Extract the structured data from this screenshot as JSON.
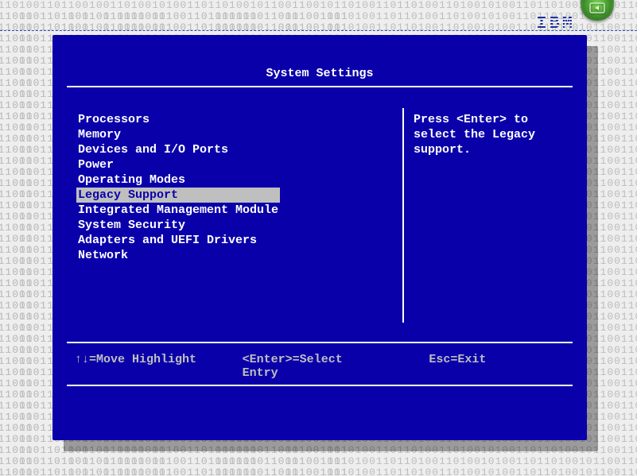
{
  "brand": "IBM",
  "title": "System Settings",
  "menu": {
    "items": [
      "Processors",
      "Memory",
      "Devices and I/O Ports",
      "Power",
      "Operating Modes",
      "Legacy Support",
      "Integrated Management Module",
      "System Security",
      "Adapters and UEFI Drivers",
      "Network"
    ],
    "selected_index": 5
  },
  "help": {
    "line1": "Press <Enter> to",
    "line2": "select the Legacy",
    "line3": "support."
  },
  "footer": {
    "move": "↑↓=Move Highlight",
    "select": "<Enter>=Select Entry",
    "exit": "Esc=Exit"
  }
}
